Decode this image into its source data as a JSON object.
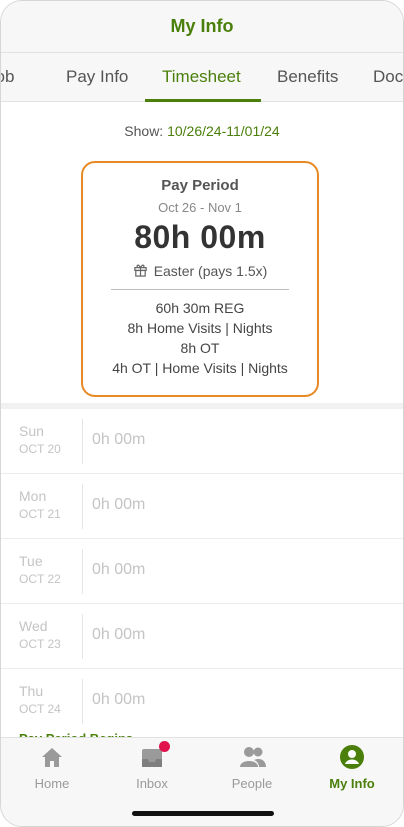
{
  "header": {
    "title": "My Info"
  },
  "tabs": [
    {
      "label": "Job"
    },
    {
      "label": "Pay Info"
    },
    {
      "label": "Timesheet"
    },
    {
      "label": "Benefits"
    },
    {
      "label": "Documents"
    }
  ],
  "show": {
    "label": "Show:",
    "range": "10/26/24-11/01/24"
  },
  "pay_period": {
    "title": "Pay Period",
    "dates": "Oct 26 - Nov 1",
    "total": "80h 00m",
    "holiday": "Easter (pays 1.5x)",
    "breakdown": [
      "60h 30m REG",
      "8h Home Visits | Nights",
      "8h OT",
      "4h OT | Home Visits | Nights"
    ]
  },
  "days": [
    {
      "day": "Sun",
      "date": "OCT 20",
      "hours": "0h 00m"
    },
    {
      "day": "Mon",
      "date": "OCT 21",
      "hours": "0h 00m"
    },
    {
      "day": "Tue",
      "date": "OCT 22",
      "hours": "0h 00m"
    },
    {
      "day": "Wed",
      "date": "OCT 23",
      "hours": "0h 00m"
    },
    {
      "day": "Thu",
      "date": "OCT 24",
      "hours": "0h 00m"
    }
  ],
  "period_begins": "Pay Period Begins",
  "bottom_nav": [
    {
      "label": "Home",
      "icon": "home-icon"
    },
    {
      "label": "Inbox",
      "icon": "inbox-icon"
    },
    {
      "label": "People",
      "icon": "people-icon"
    },
    {
      "label": "My Info",
      "icon": "profile-icon"
    }
  ],
  "colors": {
    "accent": "#4a7f0a",
    "highlight": "#e88a24",
    "badge": "#e0134d"
  }
}
